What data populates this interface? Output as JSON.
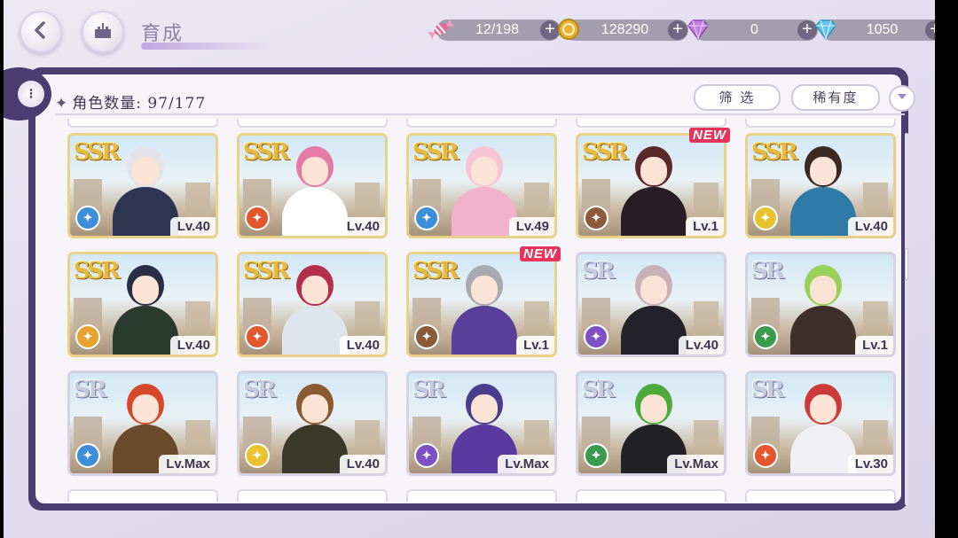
{
  "header": {
    "title": "育成",
    "back_icon": "chevron-left-icon",
    "home_icon": "castle-icon"
  },
  "resources": [
    {
      "name": "candy",
      "icon": "candy-icon",
      "value": "12/198",
      "color": "#e76a93"
    },
    {
      "name": "coin",
      "icon": "coin-icon",
      "value": "128290",
      "color": "#e8b234"
    },
    {
      "name": "paid-gem",
      "icon": "gem-icon",
      "value": "0",
      "color": "#c27ee0"
    },
    {
      "name": "free-gem",
      "icon": "diamond-icon",
      "value": "1050",
      "color": "#62c7ee"
    }
  ],
  "list": {
    "count_label": "角色数量: 97/177",
    "filter_label": "筛 选",
    "sort_label": "稀有度",
    "sort_icon": "chevron-down-icon"
  },
  "cards": [
    {
      "rarity": "SSR",
      "level": "Lv.40",
      "attr_color": "#3c8fd6",
      "new": false,
      "hair": "#e4e2ea",
      "outfit": "#2e3550"
    },
    {
      "rarity": "SSR",
      "level": "Lv.40",
      "attr_color": "#e2572d",
      "new": false,
      "hair": "#e57aa8",
      "outfit": "#ffffff"
    },
    {
      "rarity": "SSR",
      "level": "Lv.49",
      "attr_color": "#3c8fd6",
      "new": false,
      "hair": "#f7c4d6",
      "outfit": "#f3b2cc"
    },
    {
      "rarity": "SSR",
      "level": "Lv.1",
      "attr_color": "#8a5a3a",
      "new": true,
      "new_label": "NEW",
      "hair": "#5a2a2a",
      "outfit": "#2a1c24"
    },
    {
      "rarity": "SSR",
      "level": "Lv.40",
      "attr_color": "#e8c32e",
      "new": false,
      "hair": "#3a2a20",
      "outfit": "#2f7aa6"
    },
    {
      "rarity": "SSR",
      "level": "Lv.40",
      "attr_color": "#e8a32e",
      "new": false,
      "hair": "#2a2f48",
      "outfit": "#2a3a2e"
    },
    {
      "rarity": "SSR",
      "level": "Lv.40",
      "attr_color": "#e2572d",
      "new": false,
      "hair": "#b3304a",
      "outfit": "#dfe4ef"
    },
    {
      "rarity": "SSR",
      "level": "Lv.1",
      "attr_color": "#8a5a3a",
      "new": true,
      "new_label": "NEW",
      "hair": "#a7a9b3",
      "outfit": "#5a3f9a"
    },
    {
      "rarity": "SR",
      "level": "Lv.40",
      "attr_color": "#7b52c2",
      "new": false,
      "hair": "#c9b0b8",
      "outfit": "#23222a"
    },
    {
      "rarity": "SR",
      "level": "Lv.1",
      "attr_color": "#3a9a4e",
      "new": false,
      "hair": "#98d05a",
      "outfit": "#3e3028"
    },
    {
      "rarity": "SR",
      "level": "Lv.Max",
      "attr_color": "#3c8fd6",
      "new": false,
      "hair": "#d5492a",
      "outfit": "#6a4a2a"
    },
    {
      "rarity": "SR",
      "level": "Lv.40",
      "attr_color": "#e8c32e",
      "new": false,
      "hair": "#8a5a30",
      "outfit": "#3a3a2a"
    },
    {
      "rarity": "SR",
      "level": "Lv.Max",
      "attr_color": "#7b52c2",
      "new": false,
      "hair": "#4a3e8c",
      "outfit": "#5a3aa0"
    },
    {
      "rarity": "SR",
      "level": "Lv.Max",
      "attr_color": "#3a9a4e",
      "new": false,
      "hair": "#4caa3a",
      "outfit": "#222226"
    },
    {
      "rarity": "SR",
      "level": "Lv.30",
      "attr_color": "#e2572d",
      "new": false,
      "hair": "#cc3a3a",
      "outfit": "#f0f0f4"
    }
  ]
}
